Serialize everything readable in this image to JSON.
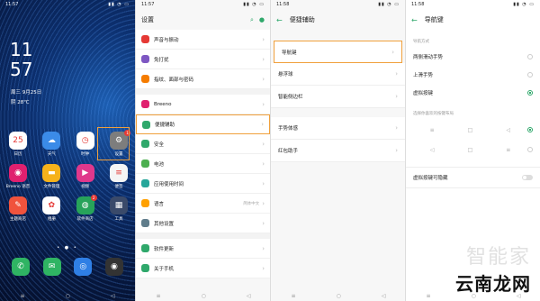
{
  "home": {
    "status_time": "11:57",
    "status_right": "▮▮ ◔ ▭",
    "clock_h": "11",
    "clock_m": "57",
    "date": "周三 9月25日",
    "weather": "阴 28℃",
    "apps": [
      {
        "label": "日历",
        "color": "#ffffff",
        "glyph": "25",
        "icon": "calendar-icon"
      },
      {
        "label": "天气",
        "color": "#3b8be8",
        "glyph": "☁",
        "icon": "weather-icon"
      },
      {
        "label": "时钟",
        "color": "#ffffff",
        "glyph": "◷",
        "icon": "clock-icon"
      },
      {
        "label": "设置",
        "color": "#7d7d7d",
        "glyph": "⚙",
        "icon": "settings-icon",
        "badge": "1"
      },
      {
        "label": "Breeno 语音",
        "color": "#e0206f",
        "glyph": "◉",
        "icon": "breeno-icon"
      },
      {
        "label": "文件管理",
        "color": "#f6b21b",
        "glyph": "▬",
        "icon": "folder-icon"
      },
      {
        "label": "视频",
        "color": "#e0388c",
        "glyph": "▶",
        "icon": "video-icon"
      },
      {
        "label": "便签",
        "color": "#f5f5f5",
        "glyph": "≡",
        "icon": "notes-icon"
      },
      {
        "label": "主题商店",
        "color": "#f0533d",
        "glyph": "✎",
        "icon": "theme-icon"
      },
      {
        "label": "相册",
        "color": "#ffffff",
        "glyph": "✿",
        "icon": "gallery-icon"
      },
      {
        "label": "软件商店",
        "color": "#27a35a",
        "glyph": "◍",
        "icon": "appstore-icon",
        "badge": "2"
      },
      {
        "label": "工具",
        "color": "#3a4a6a",
        "glyph": "▦",
        "icon": "tools-icon"
      }
    ],
    "dock": [
      {
        "color": "#2fb463",
        "glyph": "✆",
        "icon": "phone-icon"
      },
      {
        "color": "#2fb463",
        "glyph": "✉",
        "icon": "messages-icon"
      },
      {
        "color": "#2f7fe5",
        "glyph": "◎",
        "icon": "browser-icon"
      },
      {
        "color": "#333333",
        "glyph": "◉",
        "icon": "camera-icon"
      }
    ]
  },
  "settings": {
    "status_time": "11:57",
    "title": "设置",
    "items": [
      {
        "label": "声音与振动",
        "color": "#e53935",
        "icon": "sound-icon"
      },
      {
        "label": "免打扰",
        "color": "#7e57c2",
        "icon": "dnd-icon"
      },
      {
        "label": "指纹、面部与密码",
        "color": "#f57c00",
        "icon": "fingerprint-icon"
      },
      {
        "label": "Breeno",
        "color": "#e0206f",
        "icon": "breeno-small-icon"
      },
      {
        "label": "便捷辅助",
        "color": "#2fa86b",
        "icon": "assist-icon"
      },
      {
        "label": "安全",
        "color": "#2fa86b",
        "icon": "shield-icon"
      },
      {
        "label": "电池",
        "color": "#4caf50",
        "icon": "battery-icon"
      },
      {
        "label": "应用使用时间",
        "color": "#26a69a",
        "icon": "hourglass-icon"
      },
      {
        "label": "语言",
        "color": "#ffa000",
        "icon": "language-icon",
        "sub": "简体中文"
      },
      {
        "label": "其他设置",
        "color": "#607d8b",
        "icon": "more-settings-icon"
      },
      {
        "label": "软件更新",
        "color": "#2fa86b",
        "icon": "update-icon"
      },
      {
        "label": "关于手机",
        "color": "#2fa86b",
        "icon": "about-icon"
      }
    ]
  },
  "assist": {
    "status_time": "11:58",
    "title": "便捷辅助",
    "items": [
      "导航键",
      "悬浮球",
      "智能侧边栏",
      "手势体感",
      "红包助手"
    ]
  },
  "navkeys": {
    "status_time": "11:58",
    "title": "导航键",
    "section1": "导航方式",
    "options": [
      {
        "label": "两侧滑动手势",
        "on": false
      },
      {
        "label": "上滑手势",
        "on": false
      },
      {
        "label": "虚拟按键",
        "on": true
      }
    ],
    "section2": "选择你喜欢的按键布局",
    "toggle_label": "虚拟按键可隐藏"
  },
  "watermark": {
    "line1": "智能家",
    "line2": "云南龙网"
  }
}
